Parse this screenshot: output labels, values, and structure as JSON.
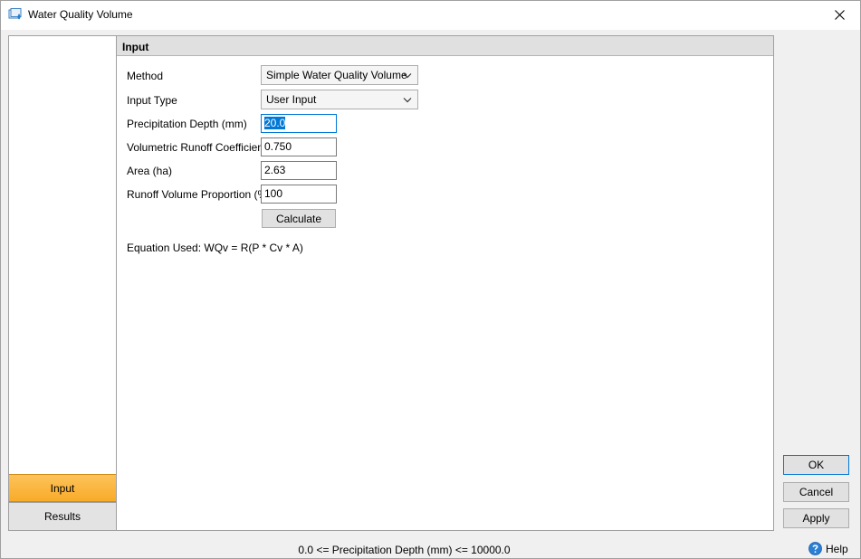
{
  "window": {
    "title": "Water Quality Volume"
  },
  "nav": {
    "items": [
      {
        "label": "Input",
        "active": true
      },
      {
        "label": "Results",
        "active": false
      }
    ]
  },
  "section": {
    "header": "Input"
  },
  "form": {
    "method_label": "Method",
    "method_value": "Simple Water Quality Volume",
    "input_type_label": "Input Type",
    "input_type_value": "User Input",
    "precip_label": "Precipitation Depth (mm)",
    "precip_value": "20.0",
    "runoff_coef_label": "Volumetric Runoff Coefficient",
    "runoff_coef_value": "0.750",
    "area_label": "Area (ha)",
    "area_value": "2.63",
    "runoff_prop_label": "Runoff Volume Proportion (%)",
    "runoff_prop_value": "100",
    "calculate_label": "Calculate",
    "equation": "Equation Used: WQv = R(P * Cv * A)"
  },
  "buttons": {
    "ok": "OK",
    "cancel": "Cancel",
    "apply": "Apply",
    "help": "Help"
  },
  "status": {
    "text": "0.0 <= Precipitation Depth (mm) <= 10000.0"
  },
  "colors": {
    "active_tab": "#f9ab29",
    "focus_accent": "#0078d7"
  }
}
